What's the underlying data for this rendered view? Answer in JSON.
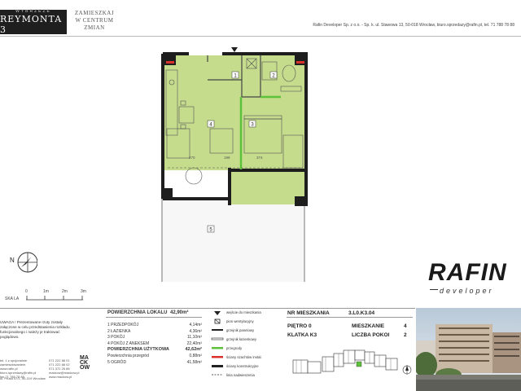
{
  "header": {
    "logo_top": "WYBRZEŻE",
    "logo_name": "REYMONTA 3",
    "tagline_lines": [
      "ZAMIESZKAJ",
      "W CENTRUM",
      "ZMIAN"
    ],
    "contact": "Rafin Developer Sp. z o.o. - Sp. k.  ul. Stawowa 13, 50-018 Wrocław, biuro.sprzedazy@rafin.pl, tel. 71 788 78 88"
  },
  "plan": {
    "room_numbers": [
      "1",
      "2",
      "3",
      "4",
      "5"
    ],
    "dimension_labels": [
      "270",
      "199",
      "374"
    ]
  },
  "scale": {
    "label": "SKA LA",
    "ticks": [
      "0",
      "1m",
      "2m",
      "3m"
    ]
  },
  "brand": {
    "name": "RAFIN",
    "sub": "developer"
  },
  "note": {
    "text": "UWAGA ! Prezentowane rzuty zostały załączone w celu przedstawienia rozkładu funkcjonalnego i należy je traktować poglądowo."
  },
  "contact_block": {
    "left": [
      "tel. 1 z opcjonalnie zamieszkiwaniem",
      "www.rafin.pl",
      "biuro.sprzedazy@rafin.pl",
      "fax 71 788 78 89"
    ],
    "right": [
      "071 222 88 01",
      "071 222 88 02",
      "071 372 26 86",
      "mackow@mackow.pl",
      "www.mackow.pl"
    ],
    "address": "ul. Prusa 47/1, 50-319 Wrocław",
    "architect": [
      "MA",
      "CK",
      "OW"
    ]
  },
  "areas": {
    "title": "POWIERZCHNIA LOKALU",
    "total": "42,90m²",
    "rooms": [
      {
        "label": "1 PRZEDPOKÓJ",
        "value": "4,14m²",
        "bold": false
      },
      {
        "label": "2 ŁAZIENKA",
        "value": "4,36m²",
        "bold": false
      },
      {
        "label": "3 POKÓJ",
        "value": "11,10m²",
        "bold": false
      },
      {
        "label": "4 POKÓJ Z ANEKSEM",
        "value": "22,40m²",
        "bold": false
      },
      {
        "label": "POWIERZCHNIA UŻYTKOWA",
        "value": "42,62m²",
        "bold": true
      },
      {
        "label": "Powierzchnia przegród",
        "value": "0,88m²",
        "bold": false
      },
      {
        "label": "5 OGRÓD",
        "value": "41,58m²",
        "bold": false
      }
    ]
  },
  "legend": [
    {
      "label": "wejście do mieszkania",
      "icon": "entry-arrow-icon"
    },
    {
      "label": "pion wentylacyjny",
      "icon": "vent-icon"
    },
    {
      "label": "grzejnik panelowy",
      "icon": "panel-heater-icon"
    },
    {
      "label": "grzejnik łazienkowy",
      "icon": "bath-heater-icon"
    },
    {
      "label": "przegrody",
      "icon": "partition-icon"
    },
    {
      "label": "ściany szachtów instal.",
      "icon": "shaft-wall-icon"
    },
    {
      "label": "ściany konstrukcyjne",
      "icon": "structural-wall-icon"
    },
    {
      "label": "linia nadwieszenia",
      "icon": "overhang-line-icon"
    }
  ],
  "apartment": {
    "nr_label": "NR MIESZKANIA",
    "nr_value": "3.L0.K3.04",
    "floor_label": "PIĘTRO 0",
    "flat_label": "MIESZKANIE",
    "flat_value": "4",
    "stair_label": "KLATKA K3",
    "rooms_label": "LICZBA POKOI",
    "rooms_value": "2"
  },
  "colors": {
    "room_fill": "#c5dc8c",
    "wall": "#1e1e1e",
    "partition_green": "#5cc23a",
    "shaft_red": "#d9322a",
    "garden_fill": "#f7f7f7"
  }
}
